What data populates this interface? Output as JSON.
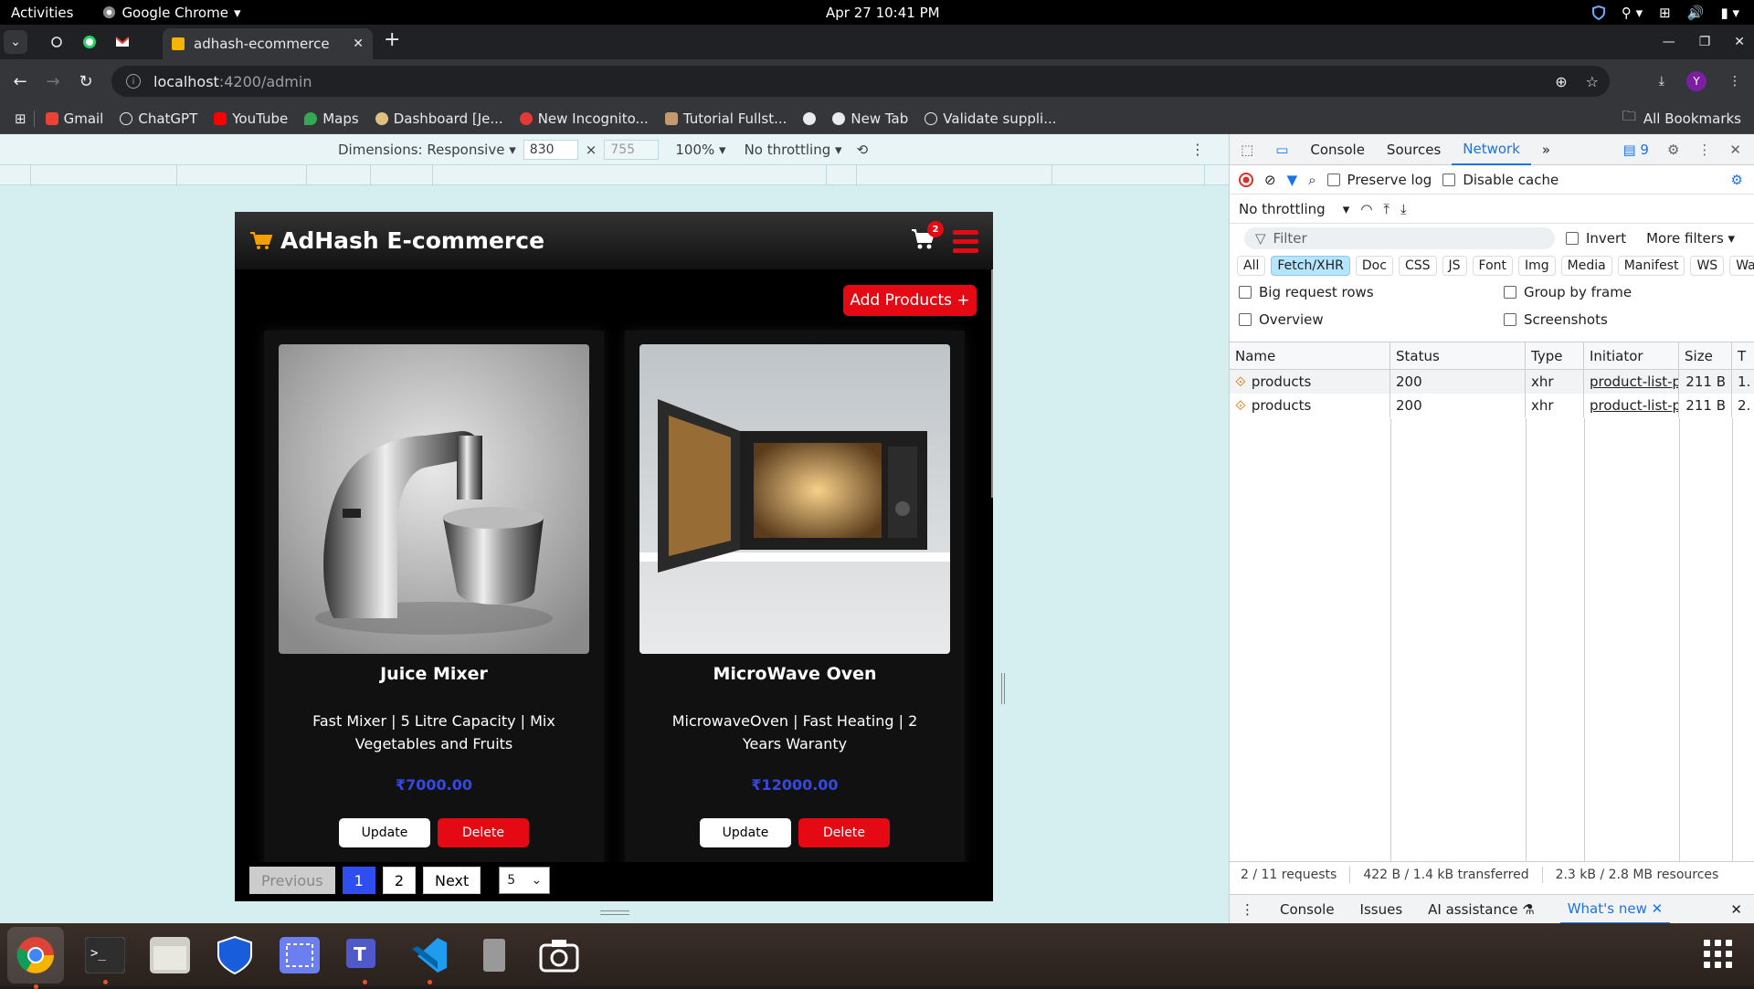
{
  "os": {
    "activities": "Activities",
    "app_name": "Google Chrome",
    "clock": "Apr 27  10:41 PM"
  },
  "browser": {
    "active_tab_title": "adhash-ecommerce",
    "url_host": "localhost",
    "url_path": ":4200/admin",
    "bookmarks": [
      "Gmail",
      "ChatGPT",
      "YouTube",
      "Maps",
      "Dashboard [Je...",
      "New Incognito...",
      "Tutorial Fullst...",
      "New Tab",
      "Validate suppli..."
    ],
    "all_bookmarks": "All Bookmarks",
    "profile_initial": "Y"
  },
  "device_toolbar": {
    "dimensions_label": "Dimensions: Responsive",
    "width": "830",
    "height": "755",
    "zoom": "100%",
    "throttling": "No throttling"
  },
  "app": {
    "brand": "AdHash E-commerce",
    "cart_count": "2",
    "add_products": "Add Products +",
    "products": [
      {
        "name": "Juice Mixer",
        "description": "Fast Mixer | 5 Litre Capacity | Mix Vegetables and Fruits",
        "price": "₹7000.00",
        "update": "Update",
        "delete": "Delete"
      },
      {
        "name": "MicroWave Oven",
        "description": "MicrowaveOven | Fast Heating | 2 Years Waranty",
        "price": "₹12000.00",
        "update": "Update",
        "delete": "Delete"
      }
    ],
    "pager": {
      "previous": "Previous",
      "pages": [
        "1",
        "2"
      ],
      "next": "Next",
      "page_size": "5"
    }
  },
  "devtools": {
    "tabs": [
      "Console",
      "Sources",
      "Network"
    ],
    "issues_count": "9",
    "preserve_log": "Preserve log",
    "disable_cache": "Disable cache",
    "throttling": "No throttling",
    "filter_placeholder": "Filter",
    "invert": "Invert",
    "more_filters": "More filters",
    "chips": [
      "All",
      "Fetch/XHR",
      "Doc",
      "CSS",
      "JS",
      "Font",
      "Img",
      "Media",
      "Manifest",
      "WS",
      "Wasm"
    ],
    "opt_big_rows": "Big request rows",
    "opt_group_frame": "Group by frame",
    "opt_overview": "Overview",
    "opt_screenshots": "Screenshots",
    "columns": [
      "Name",
      "Status",
      "Type",
      "Initiator",
      "Size",
      "T"
    ],
    "rows": [
      {
        "name": "products",
        "status": "200",
        "type": "xhr",
        "initiator": "product-list-pa",
        "size": "211 B",
        "time": "1."
      },
      {
        "name": "products",
        "status": "200",
        "type": "xhr",
        "initiator": "product-list-pa",
        "size": "211 B",
        "time": "2."
      }
    ],
    "status_requests": "2 / 11 requests",
    "status_transferred": "422 B / 1.4 kB transferred",
    "status_resources": "2.3 kB / 2.8 MB resources",
    "drawer_tabs": [
      "Console",
      "Issues",
      "AI assistance",
      "What's new"
    ]
  },
  "colors": {
    "accent_red": "#e50914",
    "price_blue": "#3548e0",
    "devtools_blue": "#1a73e8"
  }
}
